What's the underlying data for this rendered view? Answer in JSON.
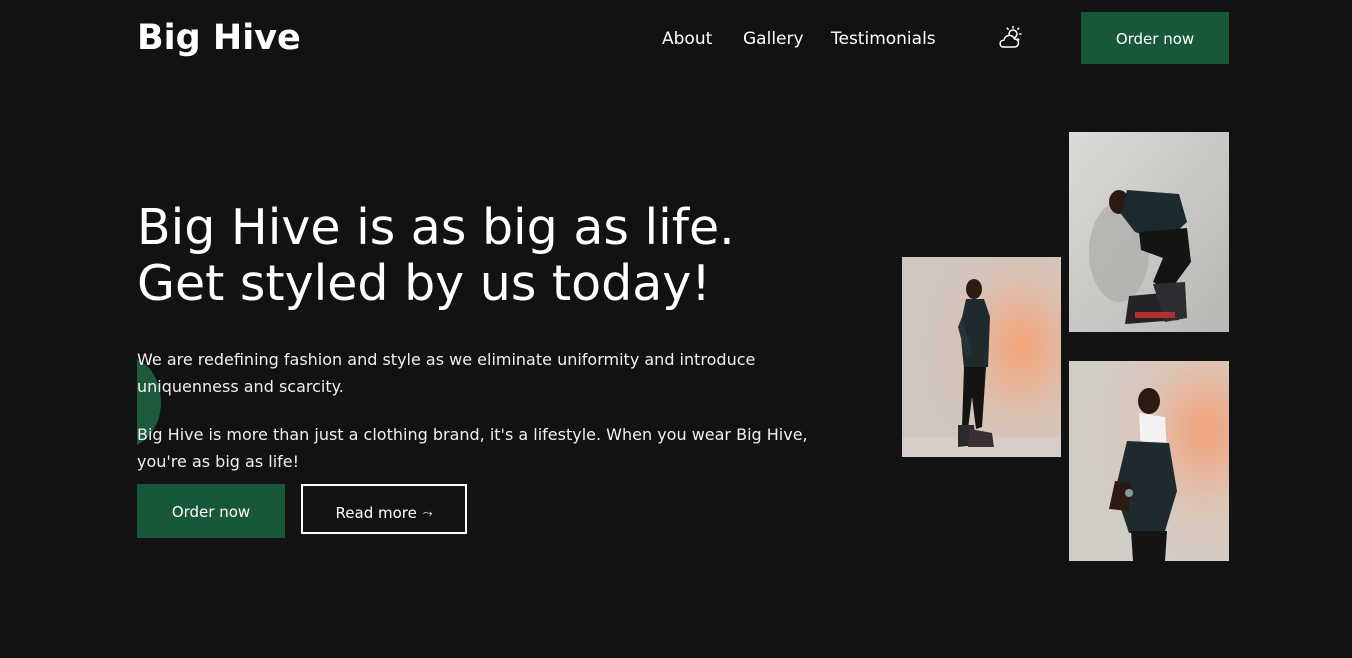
{
  "header": {
    "brand": "Big Hive",
    "nav": [
      {
        "label": "About"
      },
      {
        "label": "Gallery"
      },
      {
        "label": "Testimonials"
      }
    ],
    "theme_icon": "cloud-sun-icon",
    "order_label": "Order now"
  },
  "hero": {
    "title_line1": "Big Hive is as big as life.",
    "title_line2": "Get styled by us today!",
    "paragraph1": "We are redefining fashion and style as we eliminate uniformity and introduce uniquenness and scarcity.",
    "paragraph2": "Big Hive is more than just a clothing brand, it's a lifestyle. When you wear Big Hive, you're as big as life!",
    "order_label": "Order now",
    "read_more_label": "Read more",
    "read_more_icon": "squiggle-arrow-icon",
    "read_more_arrow": "⤳"
  },
  "gallery": {
    "photos": [
      {
        "name": "model-standing-side-photo"
      },
      {
        "name": "model-crouching-photo"
      },
      {
        "name": "model-leaning-back-photo"
      }
    ]
  },
  "colors": {
    "background": "#121212",
    "accent": "#18573a",
    "text": "#ffffff"
  }
}
